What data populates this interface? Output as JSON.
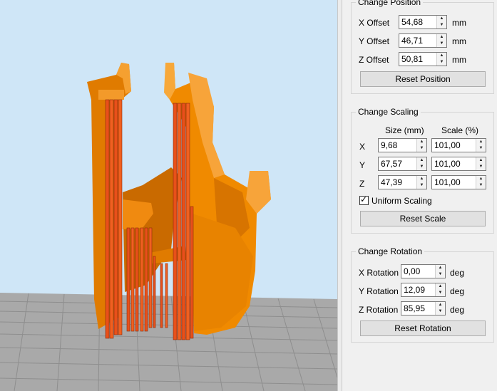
{
  "position": {
    "title": "Change Position",
    "unit": "mm",
    "rows": [
      {
        "label": "X Offset",
        "value": "54,68"
      },
      {
        "label": "Y Offset",
        "value": "46,71"
      },
      {
        "label": "Z Offset",
        "value": "50,81"
      }
    ],
    "reset_label": "Reset Position"
  },
  "scaling": {
    "title": "Change Scaling",
    "size_header": "Size (mm)",
    "scale_header": "Scale (%)",
    "rows": [
      {
        "axis": "X",
        "size": "9,68",
        "scale": "101,00"
      },
      {
        "axis": "Y",
        "size": "67,57",
        "scale": "101,00"
      },
      {
        "axis": "Z",
        "size": "47,39",
        "scale": "101,00"
      }
    ],
    "uniform_label": "Uniform Scaling",
    "uniform_checked": true,
    "reset_label": "Reset Scale"
  },
  "rotation": {
    "title": "Change Rotation",
    "unit": "deg",
    "rows": [
      {
        "label": "X Rotation",
        "value": "0,00"
      },
      {
        "label": "Y Rotation",
        "value": "12,09"
      },
      {
        "label": "Z Rotation",
        "value": "85,95"
      }
    ],
    "reset_label": "Reset Rotation"
  },
  "colors": {
    "viewport_bg": "#cfe6f7",
    "model": "#f58a00",
    "support": "#e8501a",
    "bed": "#a9a9a9"
  }
}
